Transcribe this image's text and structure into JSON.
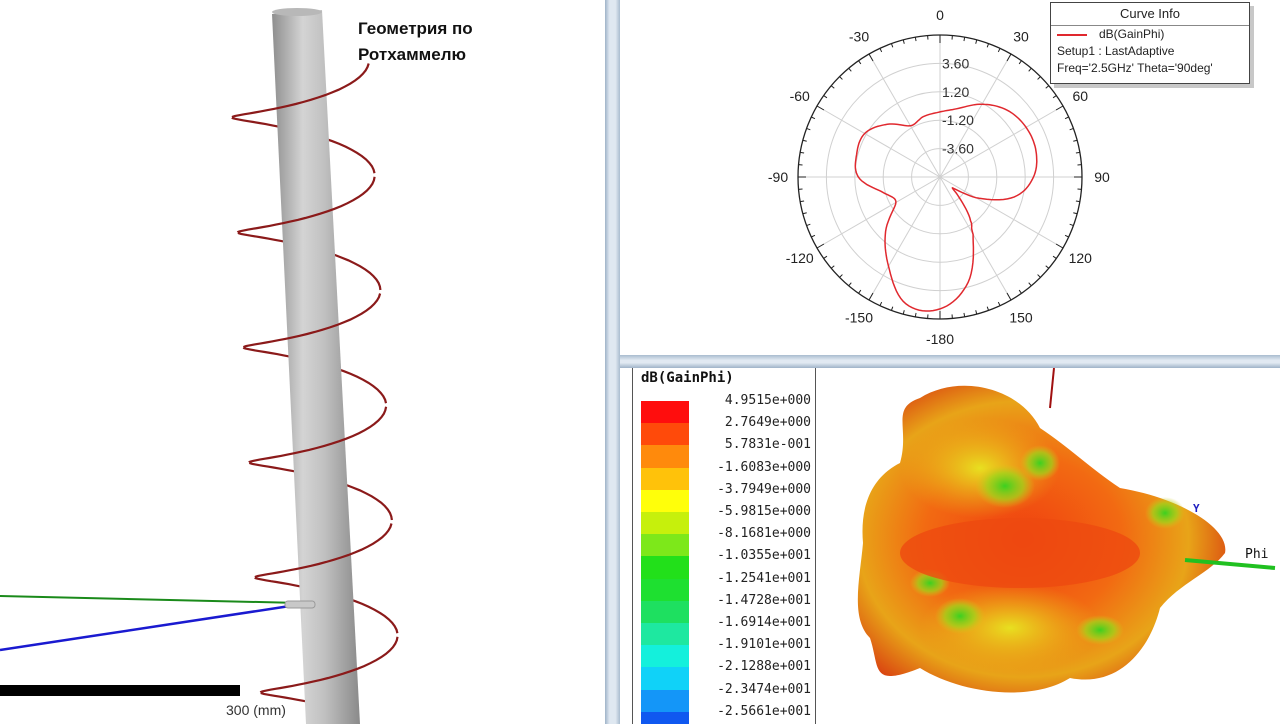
{
  "geometry_view": {
    "title_line1": "Геометрия по",
    "title_line2": "Ротхаммелю",
    "scale_label": "300 (mm)"
  },
  "curve_info": {
    "header": "Curve Info",
    "trace": "dB(GainPhi)",
    "setup": "Setup1 : LastAdaptive",
    "params": "Freq='2.5GHz' Theta='90deg'",
    "trace_color": "#e0282e"
  },
  "chart_data": {
    "type": "polar",
    "title": "",
    "series": [
      {
        "name": "dB(GainPhi)",
        "color": "#e0282e",
        "phi_deg": [
          -180,
          -165,
          -150,
          -135,
          -120,
          -105,
          -90,
          -75,
          -60,
          -45,
          -30,
          -15,
          0,
          15,
          30,
          45,
          60,
          75,
          90,
          105,
          120,
          130,
          135,
          145,
          150,
          165
        ],
        "values_db": [
          5.15,
          5.1,
          2.7,
          0.5,
          -1.7,
          -1.0,
          0.9,
          1.3,
          1.35,
          0.3,
          -1.0,
          -0.7,
          -0.5,
          0.0,
          1.1,
          2.0,
          2.4,
          2.4,
          1.9,
          0.5,
          -2.5,
          -4.5,
          -4.0,
          -1.5,
          -0.4,
          3.2
        ]
      }
    ],
    "radial_range": [
      -6.0,
      6.0
    ],
    "radial_ticks": [
      "3.60",
      "1.20",
      "-1.20",
      "-3.60"
    ],
    "radial_tick_values": [
      3.6,
      1.2,
      -1.2,
      -3.6
    ],
    "angle_labels": [
      "0",
      "30",
      "60",
      "90",
      "120",
      "150",
      "-180",
      "-150",
      "-120",
      "-90",
      "-60",
      "-30"
    ],
    "angle_values": [
      0,
      30,
      60,
      90,
      120,
      150,
      180,
      -150,
      -120,
      -90,
      -60,
      -30
    ],
    "grid": true
  },
  "pattern_legend": {
    "title": "dB(GainPhi)",
    "values": [
      "4.9515e+000",
      "2.7649e+000",
      "5.7831e-001",
      "-1.6083e+000",
      "-3.7949e+000",
      "-5.9815e+000",
      "-8.1681e+000",
      "-1.0355e+001",
      "-1.2541e+001",
      "-1.4728e+001",
      "-1.6914e+001",
      "-1.9101e+001",
      "-2.1288e+001",
      "-2.3474e+001",
      "-2.5661e+001"
    ],
    "colors": [
      "#ff0d0d",
      "#ff4a0a",
      "#ff8a0c",
      "#ffc20a",
      "#ffff0a",
      "#c6f00c",
      "#7de81a",
      "#22e01a",
      "#1ee030",
      "#1ee060",
      "#1ee8a0",
      "#14f0dc",
      "#10d2f8",
      "#1496f8",
      "#1058f0"
    ]
  },
  "pattern_view": {
    "axis_y": "Y",
    "axis_phi": "Phi"
  }
}
